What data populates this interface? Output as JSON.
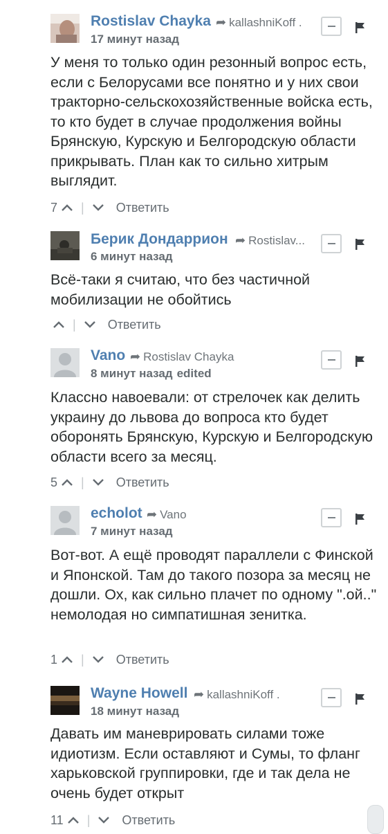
{
  "comments": [
    {
      "author": "Rostislav Chayka",
      "reply_to": "kallashniKoff .",
      "time": "17 минут назад",
      "edited": "",
      "text": "У меня то только один резонный вопрос есть, если с Белорусами все понятно и у них свои тракторно-сельскохозяйственные войска есть, то кто будет в случае продолжения войны Брянскую, Курскую и Белгородскую области прикрывать. План как то сильно хитрым выглядит.",
      "upvotes": "7",
      "reply_label": "Ответить",
      "avatar": "photo"
    },
    {
      "author": "Берик Дондаррион",
      "reply_to": "Rostislav...",
      "time": "6 минут назад",
      "edited": "",
      "text": "Всё-таки я считаю, что без частичной мобилизации не обойтись",
      "upvotes": "",
      "reply_label": "Ответить",
      "avatar": "photo"
    },
    {
      "author": "Vano",
      "reply_to": "Rostislav Chayka",
      "time": "8 минут назад",
      "edited": "edited",
      "text": "Классно навоевали: от стрелочек как делить украину до львова до вопроса кто будет оборонять Брянскую, Курскую и Белгородскую области всего за месяц.",
      "upvotes": "5",
      "reply_label": "Ответить",
      "avatar": "default"
    },
    {
      "author": "echolot",
      "reply_to": "Vano",
      "time": "7 минут назад",
      "edited": "",
      "text": "Вот-вот. А ещё проводят параллели с Финской и Японской. Там до такого позора за месяц не дошли. Ох, как сильно плачет по одному \".ой..\" немолодая но симпатишная зенитка.",
      "upvotes": "1",
      "reply_label": "Ответить",
      "avatar": "default"
    },
    {
      "author": "Wayne Howell",
      "reply_to": "kallashniKoff .",
      "time": "18 минут назад",
      "edited": "",
      "text": "Давать им маневрировать силами тоже идиотизм. Если оставляют и Сумы, то фланг харьковской группировки, где и так дела не очень будет открыт",
      "upvotes": "11",
      "reply_label": "Ответить",
      "avatar": "photo"
    }
  ],
  "icons": {
    "reply_arrow": "share-arrow-icon",
    "collapse": "minus-icon",
    "flag": "flag-icon",
    "upvote": "chevron-up-icon",
    "downvote": "chevron-down-icon"
  },
  "colors": {
    "author": "#4f7fb0",
    "text": "#2a2e2e",
    "meta": "#656c72"
  }
}
